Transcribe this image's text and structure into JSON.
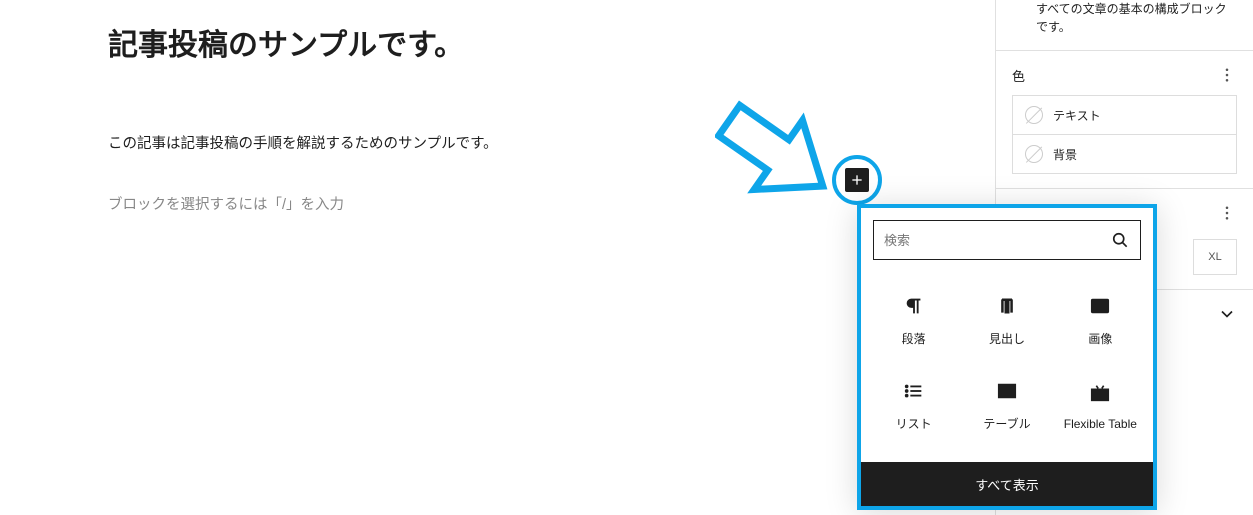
{
  "post": {
    "title": "記事投稿のサンプルです。",
    "paragraph": "この記事は記事投稿の手順を解説するためのサンプルです。",
    "placeholder": "ブロックを選択するには「/」を入力"
  },
  "inserter": {
    "search_placeholder": "検索",
    "view_all_label": "すべて表示",
    "blocks": [
      {
        "label": "段落",
        "icon": "paragraph"
      },
      {
        "label": "見出し",
        "icon": "heading"
      },
      {
        "label": "画像",
        "icon": "image"
      },
      {
        "label": "リスト",
        "icon": "list"
      },
      {
        "label": "テーブル",
        "icon": "table"
      },
      {
        "label": "Flexible Table",
        "icon": "flex-table"
      }
    ]
  },
  "sidebar": {
    "description": "すべての文章の基本の構成ブロックです。",
    "panels": {
      "color": {
        "title": "色",
        "options": [
          {
            "label": "テキスト"
          },
          {
            "label": "背景"
          }
        ]
      },
      "typography": {
        "size_label": "XL"
      }
    }
  },
  "colors": {
    "accent": "#0ea5e9"
  }
}
